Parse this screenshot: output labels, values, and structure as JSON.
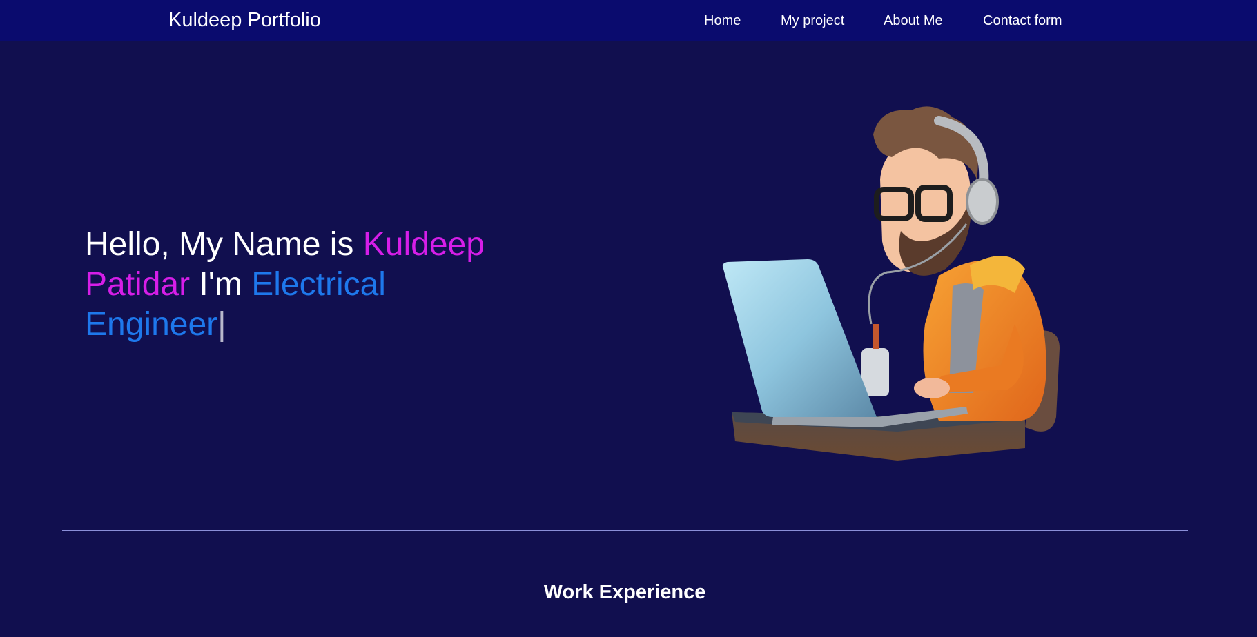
{
  "nav": {
    "brand": "Kuldeep Portfolio",
    "links": [
      "Home",
      "My project",
      "About Me",
      "Contact form"
    ]
  },
  "hero": {
    "greeting": "Hello, My Name is ",
    "name_first": "Kuldeep",
    "name_last": "Patidar",
    "role_prefix": " I'm ",
    "role": "Electrical Engineer",
    "cursor": "|"
  },
  "sections": {
    "work_experience_title": "Work Experience"
  },
  "colors": {
    "background": "#110f4f",
    "navbar": "#0a0b6e",
    "name_accent": "#d61ee8",
    "role_accent": "#1e78ec",
    "divider": "#8b8fd9"
  },
  "icons": {
    "hero_image": "developer-with-laptop-illustration"
  }
}
